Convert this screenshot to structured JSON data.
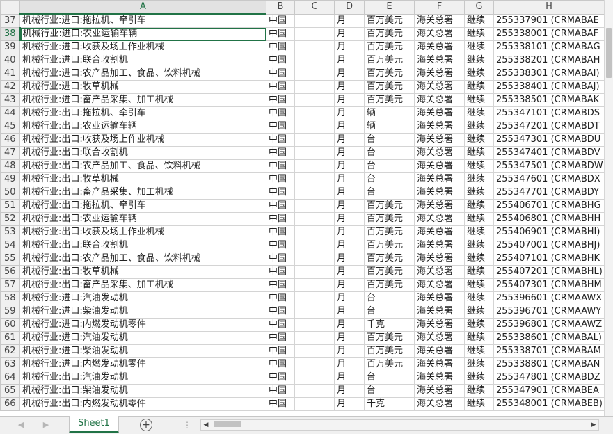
{
  "columns": [
    "A",
    "B",
    "C",
    "D",
    "E",
    "F",
    "G",
    "H"
  ],
  "rows": [
    {
      "num": "37",
      "a": "机械行业:进口:拖拉机、牵引车",
      "b": "中国",
      "c": "",
      "d": "月",
      "e": "百万美元",
      "f": "海关总署",
      "g": "继续",
      "h": "255337901 (CRMABAE"
    },
    {
      "num": "38",
      "a": "机械行业:进口:农业运输车辆",
      "b": "中国",
      "c": "",
      "d": "月",
      "e": "百万美元",
      "f": "海关总署",
      "g": "继续",
      "h": "255338001 (CRMABAF"
    },
    {
      "num": "39",
      "a": "机械行业:进口:收获及场上作业机械",
      "b": "中国",
      "c": "",
      "d": "月",
      "e": "百万美元",
      "f": "海关总署",
      "g": "继续",
      "h": "255338101 (CRMABAG"
    },
    {
      "num": "40",
      "a": "机械行业:进口:联合收割机",
      "b": "中国",
      "c": "",
      "d": "月",
      "e": "百万美元",
      "f": "海关总署",
      "g": "继续",
      "h": "255338201 (CRMABAH"
    },
    {
      "num": "41",
      "a": "机械行业:进口:农产品加工、食品、饮料机械",
      "b": "中国",
      "c": "",
      "d": "月",
      "e": "百万美元",
      "f": "海关总署",
      "g": "继续",
      "h": "255338301 (CRMABAI)"
    },
    {
      "num": "42",
      "a": "机械行业:进口:牧草机械",
      "b": "中国",
      "c": "",
      "d": "月",
      "e": "百万美元",
      "f": "海关总署",
      "g": "继续",
      "h": "255338401 (CRMABAJ)"
    },
    {
      "num": "43",
      "a": "机械行业:进口:畜产品采集、加工机械",
      "b": "中国",
      "c": "",
      "d": "月",
      "e": "百万美元",
      "f": "海关总署",
      "g": "继续",
      "h": "255338501 (CRMABAK"
    },
    {
      "num": "44",
      "a": "机械行业:出口:拖拉机、牵引车",
      "b": "中国",
      "c": "",
      "d": "月",
      "e": "辆",
      "f": "海关总署",
      "g": "继续",
      "h": "255347101 (CRMABDS"
    },
    {
      "num": "45",
      "a": "机械行业:出口:农业运输车辆",
      "b": "中国",
      "c": "",
      "d": "月",
      "e": "辆",
      "f": "海关总署",
      "g": "继续",
      "h": "255347201 (CRMABDT"
    },
    {
      "num": "46",
      "a": "机械行业:出口:收获及场上作业机械",
      "b": "中国",
      "c": "",
      "d": "月",
      "e": "台",
      "f": "海关总署",
      "g": "继续",
      "h": "255347301 (CRMABDU"
    },
    {
      "num": "47",
      "a": "机械行业:出口:联合收割机",
      "b": "中国",
      "c": "",
      "d": "月",
      "e": "台",
      "f": "海关总署",
      "g": "继续",
      "h": "255347401 (CRMABDV"
    },
    {
      "num": "48",
      "a": "机械行业:出口:农产品加工、食品、饮料机械",
      "b": "中国",
      "c": "",
      "d": "月",
      "e": "台",
      "f": "海关总署",
      "g": "继续",
      "h": "255347501 (CRMABDW"
    },
    {
      "num": "49",
      "a": "机械行业:出口:牧草机械",
      "b": "中国",
      "c": "",
      "d": "月",
      "e": "台",
      "f": "海关总署",
      "g": "继续",
      "h": "255347601 (CRMABDX"
    },
    {
      "num": "50",
      "a": "机械行业:出口:畜产品采集、加工机械",
      "b": "中国",
      "c": "",
      "d": "月",
      "e": "台",
      "f": "海关总署",
      "g": "继续",
      "h": "255347701 (CRMABDY"
    },
    {
      "num": "51",
      "a": "机械行业:出口:拖拉机、牵引车",
      "b": "中国",
      "c": "",
      "d": "月",
      "e": "百万美元",
      "f": "海关总署",
      "g": "继续",
      "h": "255406701 (CRMABHG"
    },
    {
      "num": "52",
      "a": "机械行业:出口:农业运输车辆",
      "b": "中国",
      "c": "",
      "d": "月",
      "e": "百万美元",
      "f": "海关总署",
      "g": "继续",
      "h": "255406801 (CRMABHH"
    },
    {
      "num": "53",
      "a": "机械行业:出口:收获及场上作业机械",
      "b": "中国",
      "c": "",
      "d": "月",
      "e": "百万美元",
      "f": "海关总署",
      "g": "继续",
      "h": "255406901 (CRMABHI)"
    },
    {
      "num": "54",
      "a": "机械行业:出口:联合收割机",
      "b": "中国",
      "c": "",
      "d": "月",
      "e": "百万美元",
      "f": "海关总署",
      "g": "继续",
      "h": "255407001 (CRMABHJ)"
    },
    {
      "num": "55",
      "a": "机械行业:出口:农产品加工、食品、饮料机械",
      "b": "中国",
      "c": "",
      "d": "月",
      "e": "百万美元",
      "f": "海关总署",
      "g": "继续",
      "h": "255407101 (CRMABHK"
    },
    {
      "num": "56",
      "a": "机械行业:出口:牧草机械",
      "b": "中国",
      "c": "",
      "d": "月",
      "e": "百万美元",
      "f": "海关总署",
      "g": "继续",
      "h": "255407201 (CRMABHL)"
    },
    {
      "num": "57",
      "a": "机械行业:出口:畜产品采集、加工机械",
      "b": "中国",
      "c": "",
      "d": "月",
      "e": "百万美元",
      "f": "海关总署",
      "g": "继续",
      "h": "255407301 (CRMABHM"
    },
    {
      "num": "58",
      "a": "机械行业:进口:汽油发动机",
      "b": "中国",
      "c": "",
      "d": "月",
      "e": "台",
      "f": "海关总署",
      "g": "继续",
      "h": "255396601 (CRMAAWX"
    },
    {
      "num": "59",
      "a": "机械行业:进口:柴油发动机",
      "b": "中国",
      "c": "",
      "d": "月",
      "e": "台",
      "f": "海关总署",
      "g": "继续",
      "h": "255396701 (CRMAAWY"
    },
    {
      "num": "60",
      "a": "机械行业:进口:内燃发动机零件",
      "b": "中国",
      "c": "",
      "d": "月",
      "e": "千克",
      "f": "海关总署",
      "g": "继续",
      "h": "255396801 (CRMAAWZ"
    },
    {
      "num": "61",
      "a": "机械行业:进口:汽油发动机",
      "b": "中国",
      "c": "",
      "d": "月",
      "e": "百万美元",
      "f": "海关总署",
      "g": "继续",
      "h": "255338601 (CRMABAL)"
    },
    {
      "num": "62",
      "a": "机械行业:进口:柴油发动机",
      "b": "中国",
      "c": "",
      "d": "月",
      "e": "百万美元",
      "f": "海关总署",
      "g": "继续",
      "h": "255338701 (CRMABAM"
    },
    {
      "num": "63",
      "a": "机械行业:进口:内燃发动机零件",
      "b": "中国",
      "c": "",
      "d": "月",
      "e": "百万美元",
      "f": "海关总署",
      "g": "继续",
      "h": "255338801 (CRMABAN"
    },
    {
      "num": "64",
      "a": "机械行业:出口:汽油发动机",
      "b": "中国",
      "c": "",
      "d": "月",
      "e": "台",
      "f": "海关总署",
      "g": "继续",
      "h": "255347801 (CRMABDZ"
    },
    {
      "num": "65",
      "a": "机械行业:出口:柴油发动机",
      "b": "中国",
      "c": "",
      "d": "月",
      "e": "台",
      "f": "海关总署",
      "g": "继续",
      "h": "255347901 (CRMABEA"
    },
    {
      "num": "66",
      "a": "机械行业:出口:内燃发动机零件",
      "b": "中国",
      "c": "",
      "d": "月",
      "e": "千克",
      "f": "海关总署",
      "g": "继续",
      "h": "255348001 (CRMABEB)"
    }
  ],
  "active_row": "38",
  "sheet_tab": {
    "label": "Sheet1"
  },
  "colors": {
    "accent": "#217346",
    "header_bg": "#f0f0f0",
    "grid": "#d4d4d4"
  },
  "icons": {
    "nav_prev": "chevron-left-icon",
    "nav_next": "chevron-right-icon",
    "add_sheet": "plus-circle-icon",
    "split": "vertical-dots-icon"
  }
}
